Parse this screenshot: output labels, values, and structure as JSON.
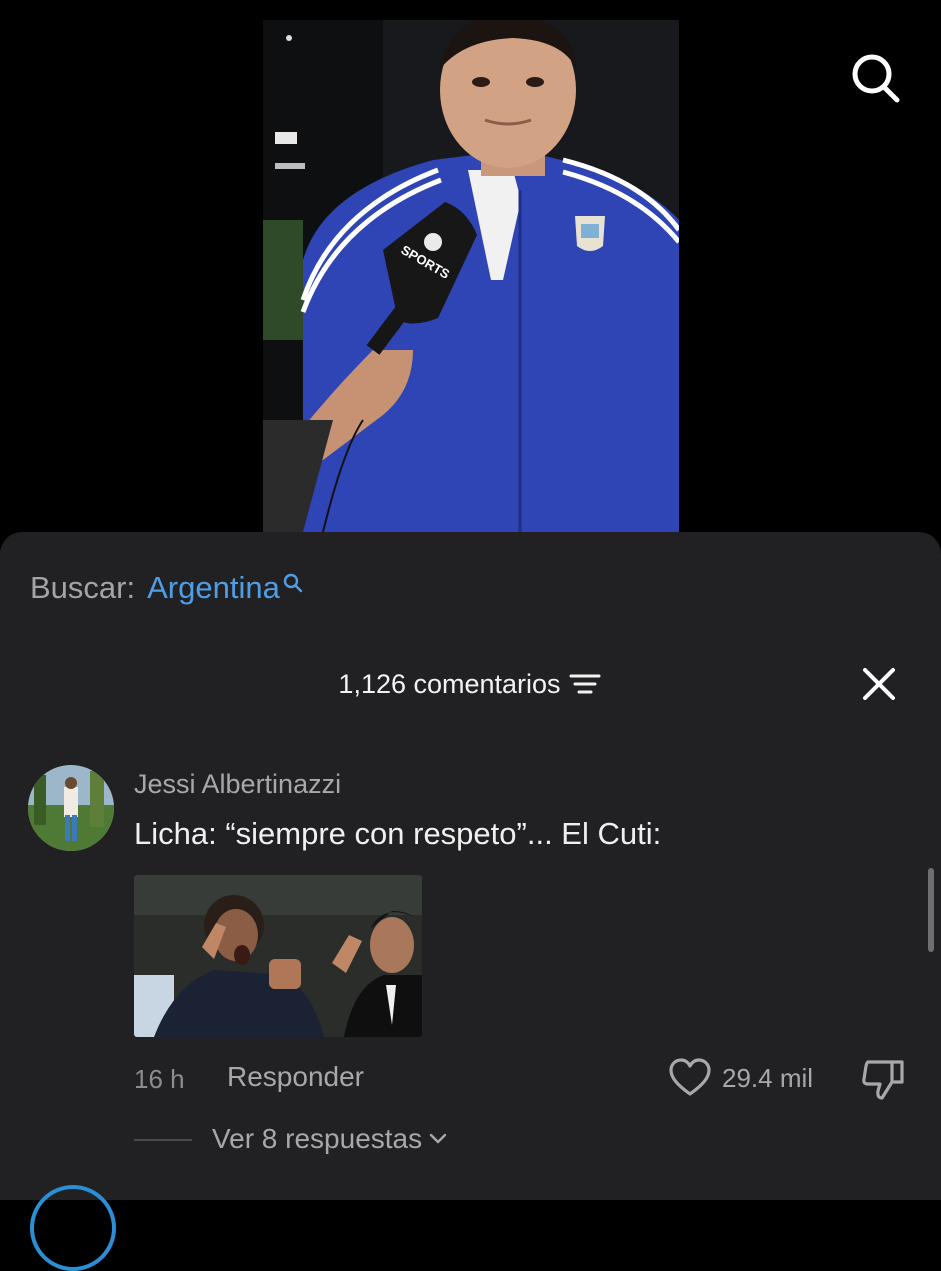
{
  "video": {
    "mic_logo": "SPORTS"
  },
  "icons": {
    "search": "search-icon",
    "close": "close-icon",
    "filter": "filter-icon",
    "heart": "heart-icon",
    "dislike": "thumbs-down-icon",
    "chevron": "chevron-down-icon"
  },
  "search_suggestion": {
    "prefix": "Buscar:",
    "term": "Argentina"
  },
  "comments": {
    "count_label": "1,126 comentarios"
  },
  "comment": {
    "username": "Jessi Albertinazzi",
    "text": "Licha: “siempre con respeto”... El Cuti:",
    "time": "16 h",
    "reply_label": "Responder",
    "likes": "29.4 mil",
    "view_replies": "Ver 8 respuestas"
  },
  "colors": {
    "accent": "#4f9ee5",
    "sheet": "#212123",
    "jacket": "#2f45b5"
  }
}
